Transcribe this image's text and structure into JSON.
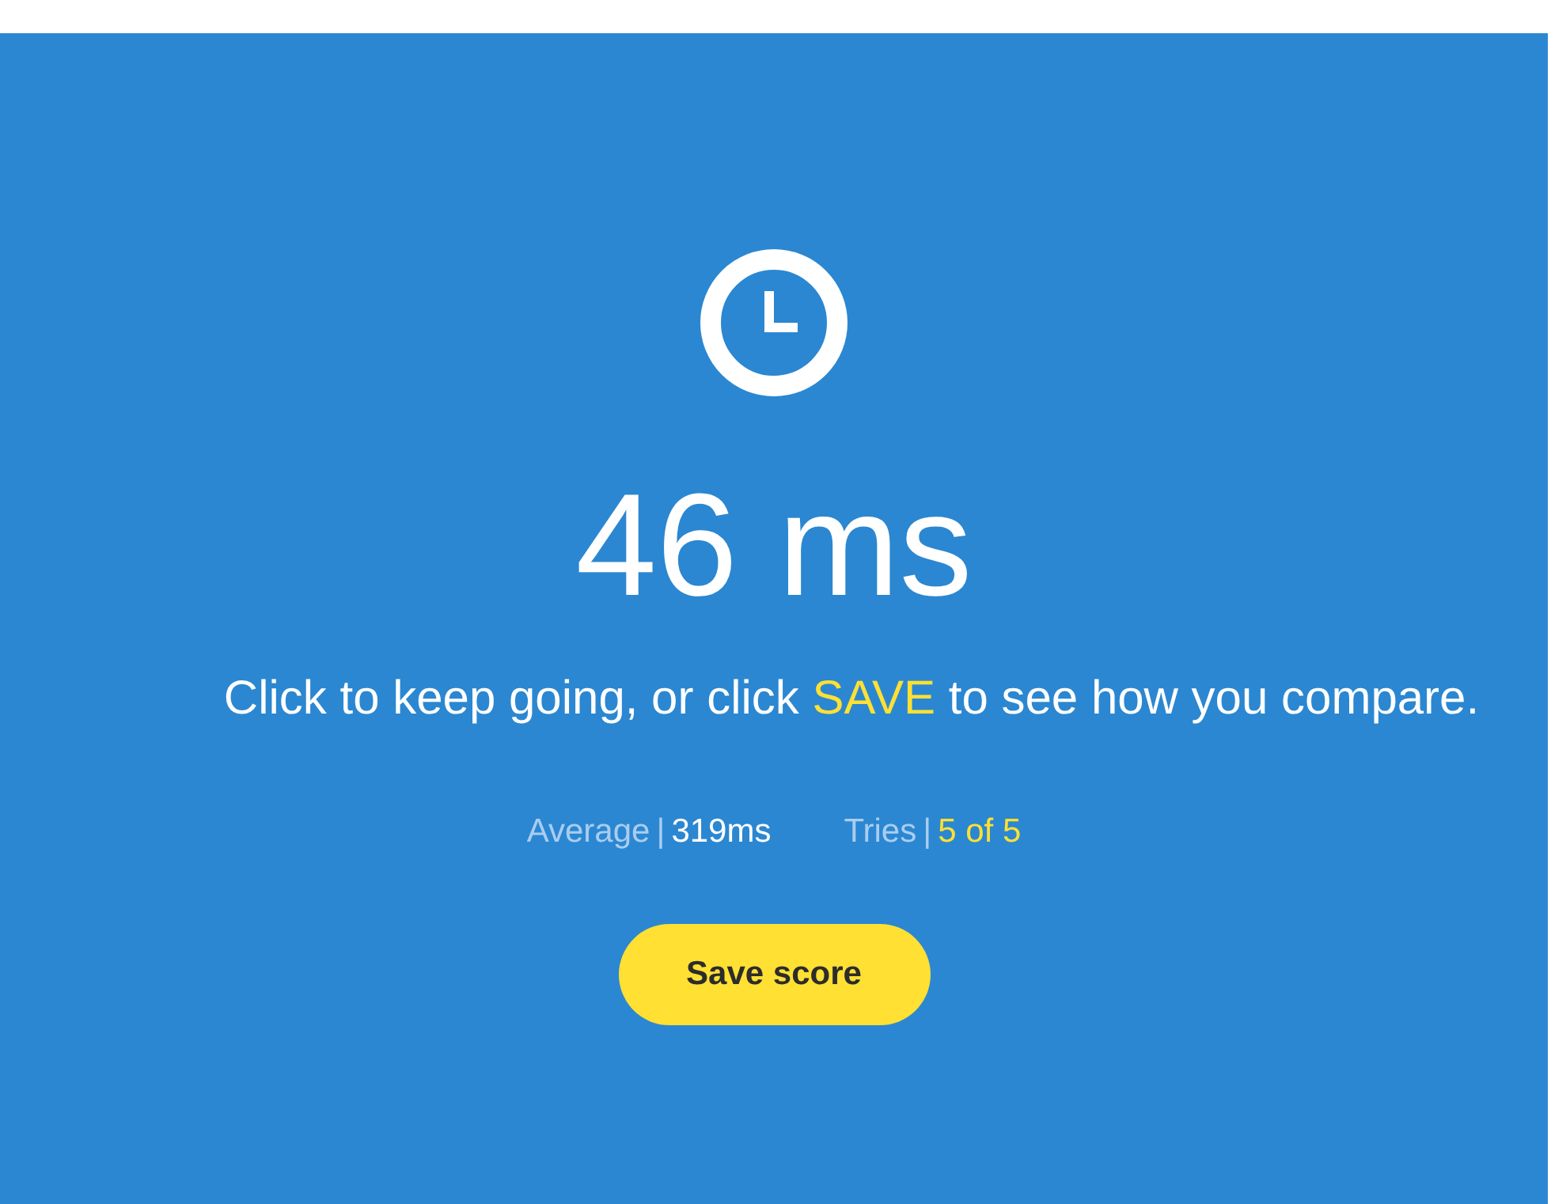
{
  "result": {
    "time": "46 ms"
  },
  "message": {
    "before": "Click to keep going, or click ",
    "highlight": "SAVE",
    "after": " to see how you compare."
  },
  "stats": [
    {
      "label": "Average",
      "separator": "|",
      "value": "319ms",
      "highlighted": false
    },
    {
      "label": "Tries",
      "separator": "|",
      "value": "5 of 5",
      "highlighted": true
    }
  ],
  "save_button": {
    "label": "Save score"
  }
}
